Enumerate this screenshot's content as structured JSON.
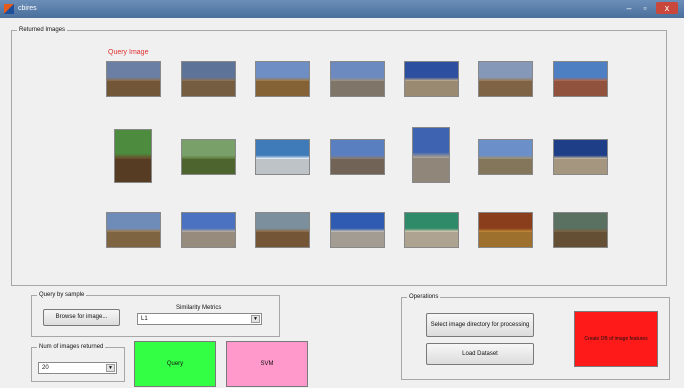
{
  "window": {
    "title": "cbires",
    "minimize": "–",
    "maximize": "▫",
    "close": "x"
  },
  "returned_images": {
    "title": "Returned Images",
    "query_label": "Query Image",
    "images": [
      {
        "name": "colosseum-query",
        "sky": "#6a7fa3",
        "ground": "#8c6a45"
      },
      {
        "name": "colosseum-2",
        "sky": "#5d7398",
        "ground": "#8e7250"
      },
      {
        "name": "ruins-sunset",
        "sky": "#6e8ec4",
        "ground": "#a27842"
      },
      {
        "name": "st-peters-square",
        "sky": "#6c8ac0",
        "ground": "#9c8f80"
      },
      {
        "name": "arch-blue",
        "sky": "#2d4fa0",
        "ground": "#bca98a"
      },
      {
        "name": "colosseum-3",
        "sky": "#8598b8",
        "ground": "#9a7a55"
      },
      {
        "name": "coastal-town",
        "sky": "#4f7fc3",
        "ground": "#b0654a"
      },
      {
        "name": "horses",
        "sky": "#4d8c3e",
        "ground": "#6a4a2a"
      },
      {
        "name": "cows-field",
        "sky": "#7aa06a",
        "ground": "#5e7a3a"
      },
      {
        "name": "snow-mountains",
        "sky": "#3f7bb8",
        "ground": "#e8eef5"
      },
      {
        "name": "cathedral",
        "sky": "#5a7fc0",
        "ground": "#8a7a6a"
      },
      {
        "name": "tower-tall",
        "sky": "#3e63b0",
        "ground": "#b0a494"
      },
      {
        "name": "temple-ruins",
        "sky": "#6b8fc8",
        "ground": "#a0906f"
      },
      {
        "name": "square-obelisk",
        "sky": "#1e3e88",
        "ground": "#c9b89c"
      },
      {
        "name": "elephants",
        "sky": "#6f8cb8",
        "ground": "#9a7a50"
      },
      {
        "name": "domed-church",
        "sky": "#4a72c0",
        "ground": "#b8aa98"
      },
      {
        "name": "elephants-2",
        "sky": "#7b8f9c",
        "ground": "#8e6a43"
      },
      {
        "name": "basilica",
        "sky": "#2f5bb2",
        "ground": "#c7bfb2"
      },
      {
        "name": "food-plate",
        "sky": "#2f8a6a",
        "ground": "#d5c6b0"
      },
      {
        "name": "mosaic-ceiling",
        "sky": "#8a3e1c",
        "ground": "#c08a38"
      },
      {
        "name": "ruins-columns",
        "sky": "#5a7060",
        "ground": "#7a6040"
      }
    ]
  },
  "query_by_sample": {
    "title": "Query by sample",
    "browse_label": "Browse for image...",
    "similarity_label": "Similarity Metrics",
    "similarity_value": "L1"
  },
  "num_images": {
    "title": "Num of images returned",
    "value": "20"
  },
  "actions": {
    "query_label": "Query",
    "svm_label": "SVM",
    "query_color": "#33ff44",
    "svm_color": "#ff99cc"
  },
  "operations": {
    "title": "Operations",
    "select_dir_label": "Select image directory for processing",
    "load_dataset_label": "Load Dataset",
    "create_db_label": "Create DB of image features",
    "create_db_color": "#ff1a1a"
  }
}
